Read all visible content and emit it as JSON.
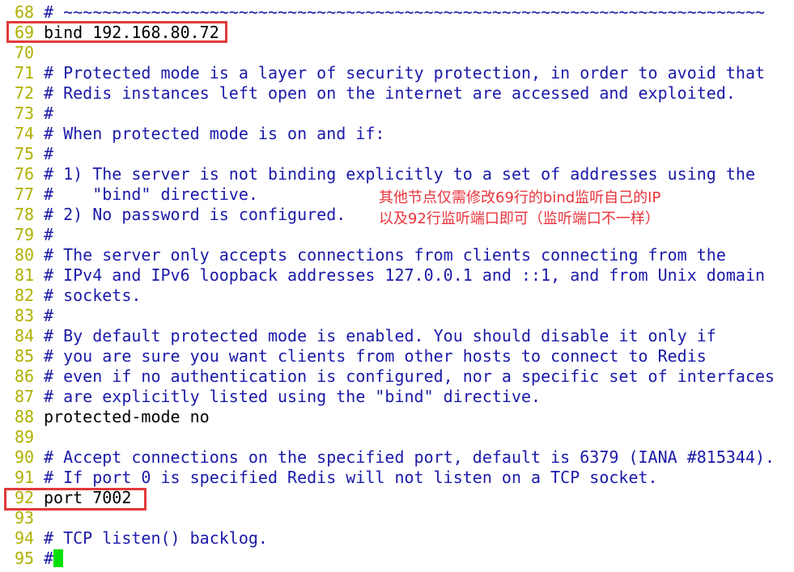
{
  "colors": {
    "line_number": "#b0b000",
    "comment": "#1a1aa8",
    "text": "#000000",
    "highlight_box": "#e03a3a",
    "annotation": "#e8343c",
    "cursor": "#00e000"
  },
  "lines": [
    {
      "n": "68",
      "t": "# ~~~~~~~~~~~~~~~~~~~~~~~~~~~~~~~~~~~~~~~~~~~~~~~~~~~~~~~~~~~~~~~~~~~~~~~~"
    },
    {
      "n": "69",
      "t": "bind 192.168.80.72"
    },
    {
      "n": "70",
      "t": ""
    },
    {
      "n": "71",
      "t": "# Protected mode is a layer of security protection, in order to avoid that"
    },
    {
      "n": "72",
      "t": "# Redis instances left open on the internet are accessed and exploited."
    },
    {
      "n": "73",
      "t": "#"
    },
    {
      "n": "74",
      "t": "# When protected mode is on and if:"
    },
    {
      "n": "75",
      "t": "#"
    },
    {
      "n": "76",
      "t": "# 1) The server is not binding explicitly to a set of addresses using the"
    },
    {
      "n": "77",
      "t": "#    \"bind\" directive."
    },
    {
      "n": "78",
      "t": "# 2) No password is configured."
    },
    {
      "n": "79",
      "t": "#"
    },
    {
      "n": "80",
      "t": "# The server only accepts connections from clients connecting from the"
    },
    {
      "n": "81",
      "t": "# IPv4 and IPv6 loopback addresses 127.0.0.1 and ::1, and from Unix domain"
    },
    {
      "n": "82",
      "t": "# sockets."
    },
    {
      "n": "83",
      "t": "#"
    },
    {
      "n": "84",
      "t": "# By default protected mode is enabled. You should disable it only if"
    },
    {
      "n": "85",
      "t": "# you are sure you want clients from other hosts to connect to Redis"
    },
    {
      "n": "86",
      "t": "# even if no authentication is configured, nor a specific set of interfaces"
    },
    {
      "n": "87",
      "t": "# are explicitly listed using the \"bind\" directive."
    },
    {
      "n": "88",
      "t": "protected-mode no"
    },
    {
      "n": "89",
      "t": ""
    },
    {
      "n": "90",
      "t": "# Accept connections on the specified port, default is 6379 (IANA #815344)."
    },
    {
      "n": "91",
      "t": "# If port 0 is specified Redis will not listen on a TCP socket."
    },
    {
      "n": "92",
      "t": "port 7002"
    },
    {
      "n": "93",
      "t": ""
    },
    {
      "n": "94",
      "t": "# TCP listen() backlog."
    },
    {
      "n": "95",
      "t": "#",
      "cursor": true
    }
  ],
  "annotation": {
    "line1": "其他节点仅需修改69行的bind监听自己的IP",
    "line2": "以及92行监听端口即可（监听端口不一样）"
  }
}
